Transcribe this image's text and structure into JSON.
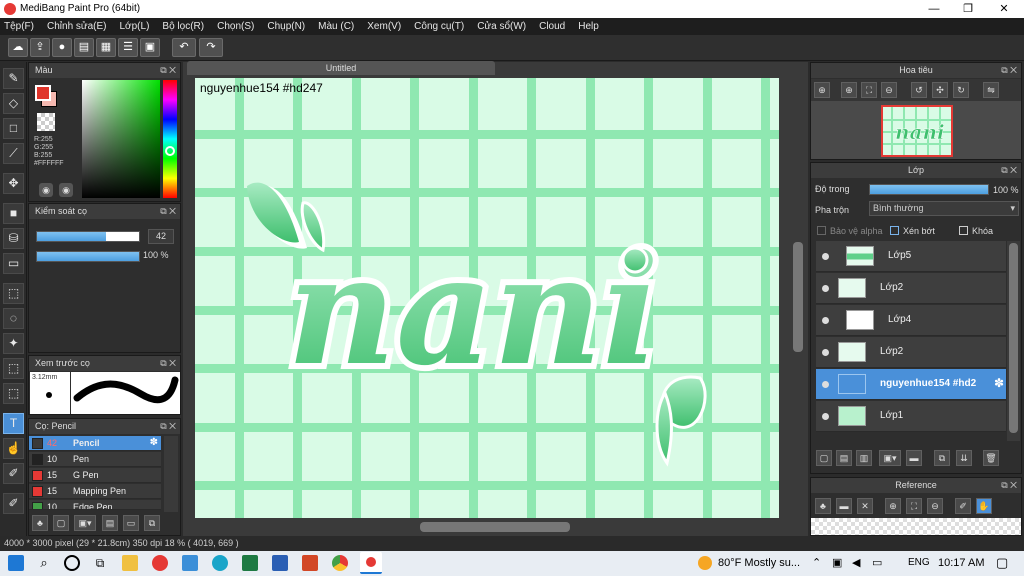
{
  "window": {
    "title": "MediBang Paint Pro (64bit)",
    "minimize": "—",
    "maximize": "❐",
    "close": "✕"
  },
  "menu": [
    "Tệp(F)",
    "Chỉnh sửa(E)",
    "Lớp(L)",
    "Bộ lọc(R)",
    "Chọn(S)",
    "Chụp(N)",
    "Màu (C)",
    "Xem(V)",
    "Công cụ(T)",
    "Cửa sổ(W)",
    "Cloud",
    "Help"
  ],
  "toolbar_icons": [
    "cloud-icon",
    "upload-icon",
    "chat-icon",
    "comment-icon",
    "grid-icon",
    "list-icon",
    "tile-icon",
    "undo-icon",
    "redo-icon"
  ],
  "color_panel": {
    "title": "Màu",
    "r": "R:255",
    "g": "G:255",
    "b": "B:255",
    "hex": "#FFFFFF",
    "primary": "#e0352b",
    "secondary": "#f5b8b0"
  },
  "brush_control": {
    "title": "Kiểm soát cọ",
    "size": "42",
    "size_fraction": 0.68,
    "opacity": "100 %",
    "opacity_fraction": 1.0
  },
  "brush_preview": {
    "title": "Xem trước cọ",
    "size_label": "3.12mm"
  },
  "brush_list": {
    "title": "Cọ: Pencil",
    "items": [
      {
        "num": "42",
        "name": "Pencil",
        "color": "#3a3a3a",
        "selected": true
      },
      {
        "num": "10",
        "name": "Pen",
        "color": "#222222",
        "selected": false
      },
      {
        "num": "15",
        "name": "G Pen",
        "color": "#e53935",
        "selected": false
      },
      {
        "num": "15",
        "name": "Mapping Pen",
        "color": "#e53935",
        "selected": false
      },
      {
        "num": "10",
        "name": "Edge Pen",
        "color": "#43a047",
        "selected": false
      }
    ]
  },
  "document": {
    "tab": "Untitled",
    "watermark": "nguyenhue154 #hd247"
  },
  "navigator": {
    "title": "Hoa tiêu"
  },
  "layer_panel": {
    "title": "Lớp",
    "opacity_label": "Độ trong",
    "opacity_value": "100 %",
    "opacity_fraction": 1.0,
    "blend_label": "Pha trộn",
    "blend_value": "Bình thường",
    "protect_alpha": "Bảo vệ alpha",
    "clipping": "Xén bớt",
    "lock": "Khóa",
    "layers": [
      {
        "name": "Lớp5",
        "selected": false,
        "indent": true
      },
      {
        "name": "Lớp2",
        "selected": false,
        "indent": false
      },
      {
        "name": "Lớp4",
        "selected": false,
        "indent": true
      },
      {
        "name": "Lớp2",
        "selected": false,
        "indent": false
      },
      {
        "name": "nguyenhue154 #hd2",
        "selected": true,
        "indent": false
      },
      {
        "name": "Lớp1",
        "selected": false,
        "indent": false
      }
    ]
  },
  "reference": {
    "title": "Reference"
  },
  "status": {
    "text": "4000 * 3000 pixel   (29 * 21.8cm)   350 dpi   18 %   ( 4019, 669 )"
  },
  "taskbar": {
    "weather": "80°F  Mostly su...",
    "lang": "ENG",
    "time": "10:17 AM"
  }
}
